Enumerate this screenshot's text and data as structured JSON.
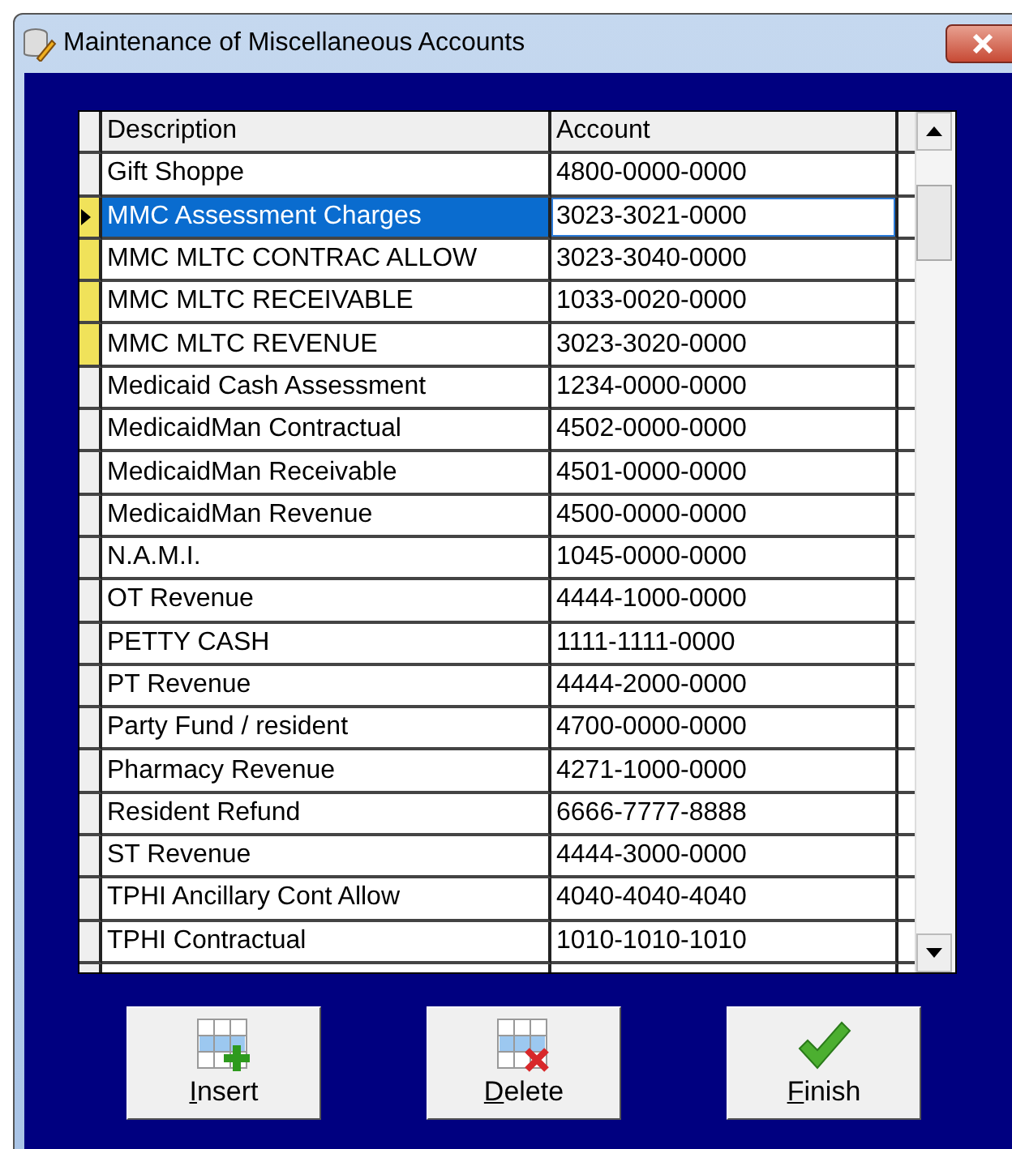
{
  "window": {
    "title": "Maintenance of Miscellaneous Accounts"
  },
  "table": {
    "columns": [
      "Description",
      "Account"
    ],
    "rows": [
      {
        "description": "Gift Shoppe",
        "account": "4800-0000-0000",
        "selected": false,
        "marked": false
      },
      {
        "description": "MMC Assessment Charges",
        "account": "3023-3021-0000",
        "selected": true,
        "marked": true
      },
      {
        "description": "MMC MLTC CONTRAC ALLOW",
        "account": "3023-3040-0000",
        "selected": false,
        "marked": true
      },
      {
        "description": "MMC MLTC RECEIVABLE",
        "account": "1033-0020-0000",
        "selected": false,
        "marked": true
      },
      {
        "description": "MMC MLTC REVENUE",
        "account": "3023-3020-0000",
        "selected": false,
        "marked": true
      },
      {
        "description": "Medicaid Cash Assessment",
        "account": "1234-0000-0000",
        "selected": false,
        "marked": false
      },
      {
        "description": "MedicaidMan Contractual",
        "account": "4502-0000-0000",
        "selected": false,
        "marked": false
      },
      {
        "description": "MedicaidMan Receivable",
        "account": "4501-0000-0000",
        "selected": false,
        "marked": false
      },
      {
        "description": "MedicaidMan Revenue",
        "account": "4500-0000-0000",
        "selected": false,
        "marked": false
      },
      {
        "description": "N.A.M.I.",
        "account": "1045-0000-0000",
        "selected": false,
        "marked": false
      },
      {
        "description": "OT Revenue",
        "account": "4444-1000-0000",
        "selected": false,
        "marked": false
      },
      {
        "description": "PETTY CASH",
        "account": "1111-1111-0000",
        "selected": false,
        "marked": false
      },
      {
        "description": "PT Revenue",
        "account": "4444-2000-0000",
        "selected": false,
        "marked": false
      },
      {
        "description": "Party Fund / resident",
        "account": "4700-0000-0000",
        "selected": false,
        "marked": false
      },
      {
        "description": "Pharmacy Revenue",
        "account": "4271-1000-0000",
        "selected": false,
        "marked": false
      },
      {
        "description": "Resident Refund",
        "account": "6666-7777-8888",
        "selected": false,
        "marked": false
      },
      {
        "description": "ST Revenue",
        "account": "4444-3000-0000",
        "selected": false,
        "marked": false
      },
      {
        "description": "TPHI Ancillary Cont Allow",
        "account": "4040-4040-4040",
        "selected": false,
        "marked": false
      },
      {
        "description": "TPHI Contractual",
        "account": "1010-1010-1010",
        "selected": false,
        "marked": false
      }
    ]
  },
  "buttons": [
    {
      "kind": "insert",
      "label": "Insert"
    },
    {
      "kind": "delete",
      "label": "Delete"
    },
    {
      "kind": "finish",
      "label": "Finish"
    }
  ]
}
